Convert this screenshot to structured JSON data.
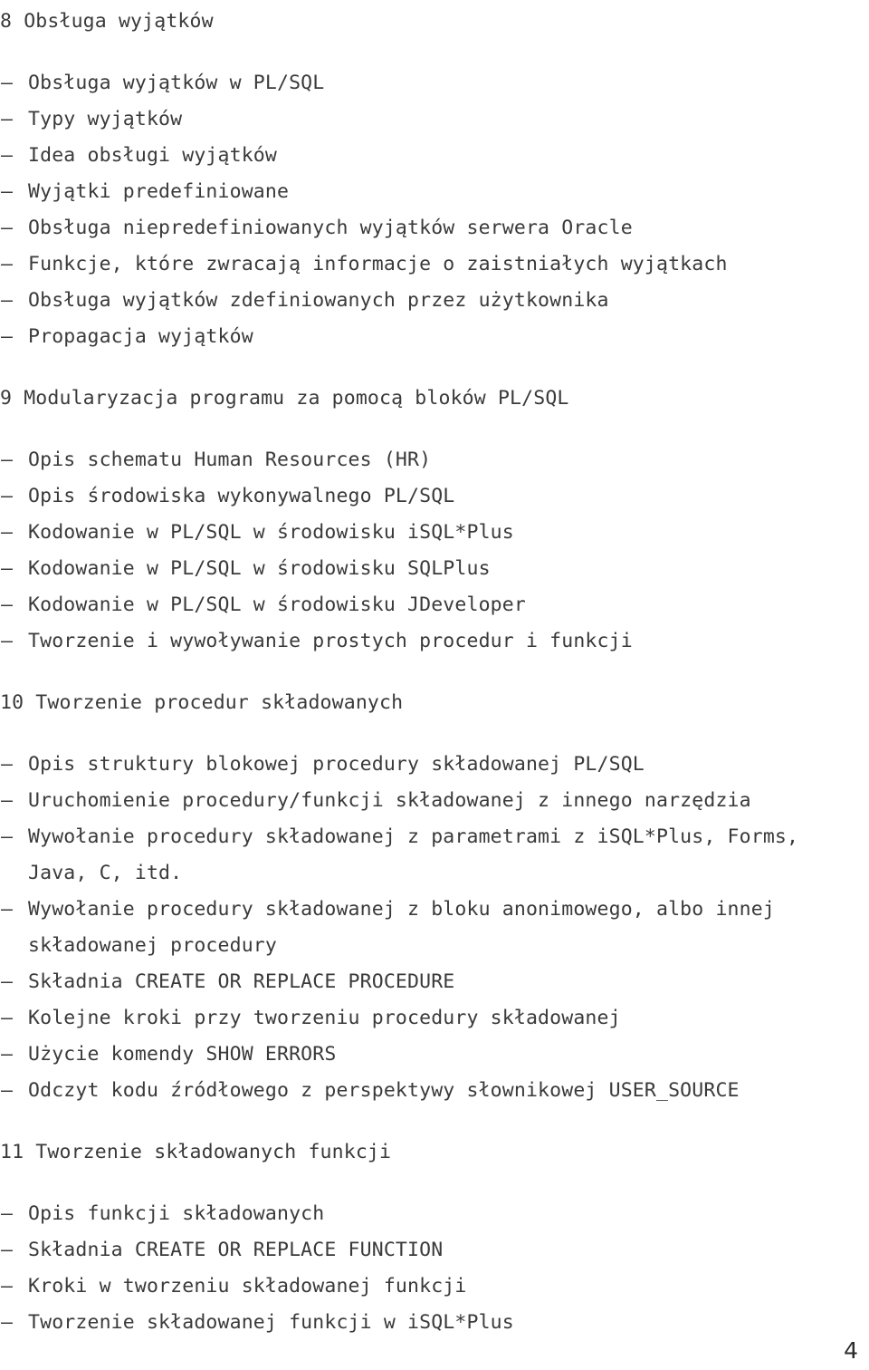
{
  "page": {
    "number": "4",
    "language": "pl"
  },
  "sections": [
    {
      "heading": "8 Obsługa wyjątków",
      "items": [
        {
          "bullet": "–",
          "text": "Obsługa wyjątków w PL/SQL"
        },
        {
          "bullet": "–",
          "text": "Typy wyjątków"
        },
        {
          "bullet": "–",
          "text": "Idea obsługi wyjątków"
        },
        {
          "bullet": "–",
          "text": "Wyjątki predefiniowane"
        },
        {
          "bullet": "–",
          "text": "Obsługa niepredefiniowanych wyjątków serwera Oracle"
        },
        {
          "bullet": "–",
          "text": "Funkcje, które zwracają informacje o zaistniałych wyjątkach"
        },
        {
          "bullet": "–",
          "text": "Obsługa wyjątków zdefiniowanych przez użytkownika"
        },
        {
          "bullet": "–",
          "text": "Propagacja wyjątków"
        }
      ]
    },
    {
      "heading": "9 Modularyzacja programu za pomocą bloków PL/SQL",
      "items": [
        {
          "bullet": "–",
          "text": "Opis schematu Human Resources (HR)"
        },
        {
          "bullet": "–",
          "text": "Opis środowiska wykonywalnego PL/SQL"
        },
        {
          "bullet": "–",
          "text": "Kodowanie w PL/SQL w środowisku iSQL*Plus"
        },
        {
          "bullet": "–",
          "text": "Kodowanie w PL/SQL w środowisku SQLPlus"
        },
        {
          "bullet": "–",
          "text": "Kodowanie w PL/SQL w środowisku JDeveloper"
        },
        {
          "bullet": "–",
          "text": "Tworzenie i wywoływanie prostych procedur i funkcji"
        }
      ]
    },
    {
      "heading": "10 Tworzenie procedur składowanych",
      "items": [
        {
          "bullet": "–",
          "text": "Opis struktury blokowej procedury składowanej PL/SQL"
        },
        {
          "bullet": "–",
          "text": "Uruchomienie procedury/funkcji składowanej z innego narzędzia"
        },
        {
          "bullet": "–",
          "text": "Wywołanie procedury składowanej z parametrami z iSQL*Plus, Forms,",
          "continuation": "Java, C, itd."
        },
        {
          "bullet": "–",
          "text": "Wywołanie procedury składowanej z bloku anonimowego, albo innej",
          "continuation": "składowanej procedury"
        },
        {
          "bullet": "–",
          "text": "Składnia CREATE OR REPLACE PROCEDURE"
        },
        {
          "bullet": "–",
          "text": "Kolejne kroki przy tworzeniu procedury składowanej"
        },
        {
          "bullet": "–",
          "text": "Użycie komendy SHOW ERRORS"
        },
        {
          "bullet": "–",
          "text": "Odczyt kodu źródłowego z perspektywy słownikowej USER_SOURCE"
        }
      ]
    },
    {
      "heading": "11 Tworzenie składowanych funkcji",
      "items": [
        {
          "bullet": "–",
          "text": "Opis funkcji składowanych"
        },
        {
          "bullet": "–",
          "text": "Składnia CREATE OR REPLACE FUNCTION"
        },
        {
          "bullet": "–",
          "text": "Kroki w tworzeniu składowanej funkcji"
        },
        {
          "bullet": "–",
          "text": "Tworzenie składowanej funkcji w iSQL*Plus"
        }
      ]
    }
  ]
}
